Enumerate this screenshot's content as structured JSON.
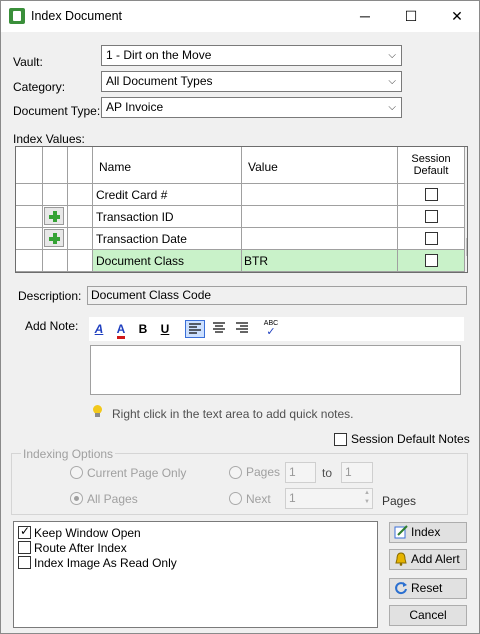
{
  "window": {
    "title": "Index Document",
    "minimize": "─",
    "maximize": "☐",
    "close": "✕"
  },
  "form": {
    "vault_label": "Vault:",
    "vault_value": "1 - Dirt on the Move",
    "category_label": "Category:",
    "category_value": "All Document Types",
    "doctype_label": "Document Type:",
    "doctype_value": "AP Invoice",
    "combo_arrow": "⌵"
  },
  "index_values": {
    "label": "Index Values:",
    "headers": {
      "name": "Name",
      "value": "Value",
      "session_default": "Session Default"
    },
    "rows": [
      {
        "name": "Credit Card #",
        "value": "",
        "has_plus": false,
        "selected": false
      },
      {
        "name": "Transaction ID",
        "value": "",
        "has_plus": true,
        "selected": false
      },
      {
        "name": "Transaction Date",
        "value": "",
        "has_plus": true,
        "selected": false
      },
      {
        "name": "Document Class",
        "value": "BTR",
        "has_plus": false,
        "selected": true
      }
    ],
    "scroll_up": "▲",
    "scroll_down": "▼"
  },
  "description": {
    "label": "Description:",
    "value": "Document Class Code"
  },
  "add_note": {
    "label": "Add Note:",
    "toolbar": {
      "bold": "B",
      "underline": "U",
      "font_icon": "font-icon",
      "color_icon": "font-color-icon",
      "spell": "ABC"
    },
    "hint": "Right click in the text area to add quick notes.",
    "session_default_notes": "Session Default Notes"
  },
  "indexing_options": {
    "legend": "Indexing Options",
    "current_page_only": "Current Page Only",
    "all_pages": "All Pages",
    "pages": "Pages",
    "pages_from": "1",
    "to": "to",
    "pages_to": "1",
    "next": "Next",
    "next_value": "1",
    "pages_suffix": "Pages"
  },
  "options": [
    {
      "label": "Keep Window Open",
      "checked": true
    },
    {
      "label": "Route After Index",
      "checked": false
    },
    {
      "label": "Index Image As Read Only",
      "checked": false
    }
  ],
  "buttons": {
    "index": "Index",
    "add_alert": "Add Alert",
    "reset": "Reset",
    "cancel": "Cancel"
  },
  "colors": {
    "selected_row": "#c9f2c9",
    "accent_blue": "#1f3fbf",
    "font_red": "#d01818"
  }
}
